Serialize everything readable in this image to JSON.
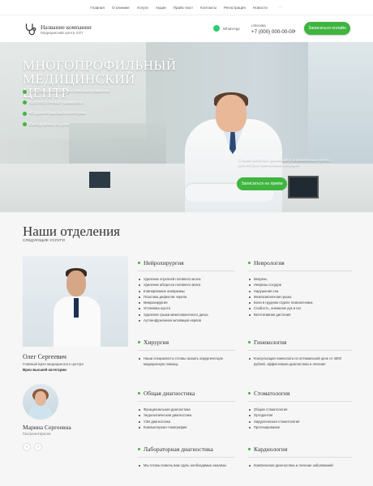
{
  "topnav": {
    "items": [
      "Главная",
      "О клинике",
      "Услуги",
      "Акции",
      "Прайс-лист",
      "Контакты",
      "Регистрация",
      "Новости"
    ],
    "more": "···"
  },
  "header": {
    "company_name": "Название компании",
    "company_sub": "Медицинский центр 24/7",
    "whatsapp_label": "WhatsApp",
    "city": "г.Москва",
    "phone": "+7 (000) 000-00-00",
    "cta": "Записаться онлайн"
  },
  "hero": {
    "title": "МНОГОПРОФИЛЬНЫЙ МЕДИЦИНСКИЙ ЦЕНТР",
    "features": [
      "Современный диагностический комплекс",
      "Круглосуточный травмпункт",
      "40 врачей высшей категории",
      "Выезд врача на дом"
    ],
    "note": "С Вами работают думающие и внимательные врачи, для которых важна Ваша ситуация.",
    "cta": "Записаться на приём"
  },
  "section": {
    "title": "Наши отделения",
    "subtitle": "СЛЕДУЮЩИЕ УСЛУГИ"
  },
  "doctors": [
    {
      "name": "Олег Сергеевич",
      "role": "Главный врач медицинского центра",
      "category": "Врач высшей категории"
    },
    {
      "name": "Марина Сергеевна",
      "role": "Гастроэнтеролог"
    }
  ],
  "slider": {
    "prev": "‹",
    "next": "›"
  },
  "departments": [
    {
      "title": "Нейрохирургия",
      "items": [
        "Удаление опухолей головного мозга",
        "Удаление абсцесса головного мозга",
        "Клипирование аневризмы",
        "Пластика дефектов черепа",
        "Микрохирургия",
        "Установка шунта",
        "Удаление грыжи межпозвоночного диска",
        "Аутоинфузионная активация нервов"
      ]
    },
    {
      "title": "Неврология",
      "items": [
        "Мигрень",
        "Неврозы сосудов",
        "Нарушения сна",
        "Межпозвоночная грыжа",
        "Боли в грудном отделе позвоночника",
        "Слабость, онемение рук и ног",
        "Вегетативная дистония"
      ]
    },
    {
      "title": "Хирургия",
      "items": [
        "Наши специалисты готовы оказать хирургическую медицинскую помощь"
      ]
    },
    {
      "title": "Гинекология",
      "items": [
        "Консультация гинеколога по оптимальной цене от 4000 рублей, эффективная диагностика и лечение"
      ]
    },
    {
      "title": "Общая диагностика",
      "items": [
        "Функциональная диагностика",
        "Эндоскопическая диагностика",
        "УЗИ диагностика",
        "Компьютерная томография"
      ]
    },
    {
      "title": "Стоматология",
      "items": [
        "Общая стоматология",
        "Ортодонтия",
        "Хирургическая стоматология",
        "Протезирование"
      ]
    },
    {
      "title": "Лабораторная диагностика",
      "items": [
        "Мы готовы помочь вам сдать необходимые анализы"
      ]
    },
    {
      "title": "Кардиология",
      "items": [
        "Комплексная диагностика и лечение заболеваний"
      ]
    }
  ],
  "colors": {
    "accent": "#3fb43f",
    "text": "#333333"
  }
}
